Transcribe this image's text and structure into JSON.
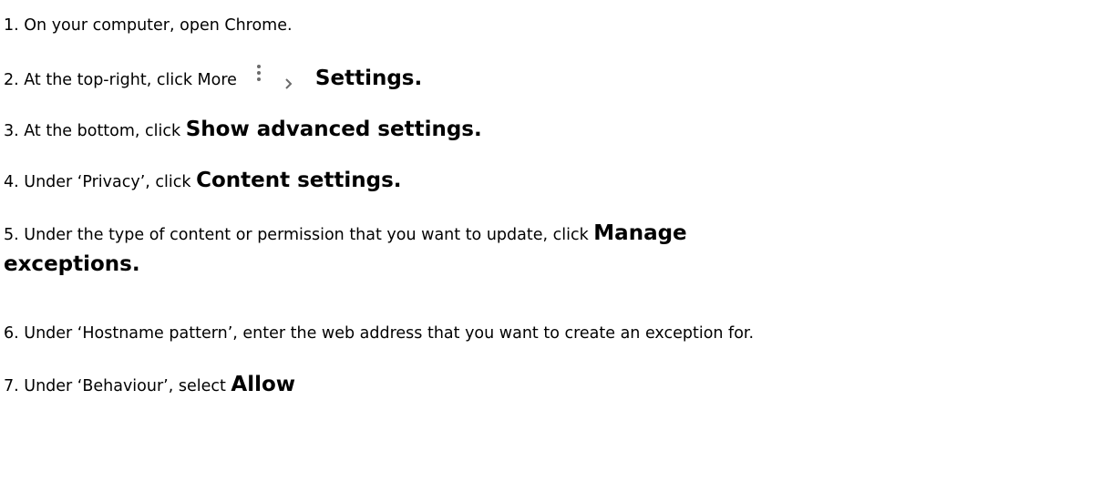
{
  "steps": [
    {
      "prefix": "1. On your computer, open Chrome."
    },
    {
      "prefix": "2. At the top-right, click More",
      "icon_more": "more-vert-icon",
      "icon_chev": "chevron-right-icon",
      "bold": "Settings."
    },
    {
      "prefix": "3. At the bottom, click ",
      "bold": "Show advanced settings."
    },
    {
      "prefix": "4. Under ‘Privacy’, click ",
      "bold": "Content settings."
    },
    {
      "prefix": "5. Under the type of content or permission that you want to update, click ",
      "bold": "Manage exceptions."
    },
    {
      "prefix": "6. Under ‘Hostname pattern’, enter the web address that you want to create an exception for."
    },
    {
      "prefix": "7. Under ‘Behaviour’, select ",
      "bold": "Allow"
    }
  ]
}
